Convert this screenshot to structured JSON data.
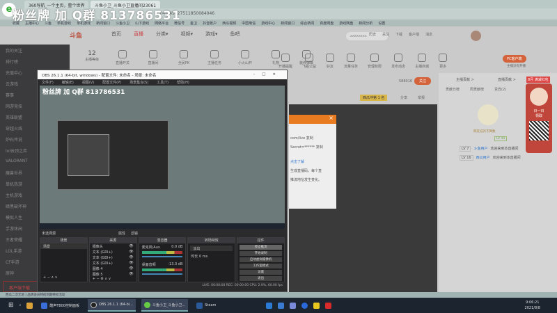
{
  "browser": {
    "tabs": [
      "360导航_一个主页，整个世界",
      "斗鱼小卫_斗鱼小卫直播间23061"
    ],
    "address": "r=0.45627511850084046",
    "bookmarks": [
      "收藏",
      "主播中心",
      "斗鱼",
      "单机游戏",
      "单机游戏",
      "新闻窗口",
      "斗鱼小卫",
      "山下游戏",
      "网络平台",
      "微信号",
      "金卫",
      "抖音账户",
      "西瓜视频",
      "中国电信",
      "游戏中心",
      "新闻窗口",
      "综合新闻",
      "百度网盘",
      "游戏网盘",
      "新闻分析",
      "设置"
    ]
  },
  "overlay_text": "粉丝牌 加 Q群 813786531",
  "site": {
    "logo": "斗鱼",
    "nav": [
      "首页",
      "直播",
      "分类▾",
      "视频▾",
      "游戏▾",
      "鱼吧"
    ],
    "search_placeholder": "xxxxxxxx",
    "header_icons": [
      "历史",
      "关注",
      "下载",
      "客户端",
      "消息"
    ],
    "icons": [
      {
        "value": "12",
        "label": "主播等级"
      },
      {
        "label": "直播开关"
      },
      {
        "label": "直播间"
      },
      {
        "label": "全民PK"
      },
      {
        "label": "主播任务"
      },
      {
        "label": "小火山开"
      },
      {
        "label": "礼物"
      },
      {
        "label": "装修弹幕"
      },
      {
        "label": "开播提醒"
      },
      {
        "label": "飞船公益"
      },
      {
        "label": "好友"
      },
      {
        "label": "流量任务"
      },
      {
        "label": "管理权限"
      },
      {
        "label": "发布动态"
      },
      {
        "label": "主播商城"
      },
      {
        "label": "更多"
      }
    ],
    "pc_button": "PC客户端",
    "pc_sub": "主播没有开播",
    "count": "588016",
    "follow": "关注",
    "rank_badge": "西瓜冲第 1 名",
    "share": "分享",
    "report": "举报",
    "rank_links": [
      "主播贡献 >",
      "直播贡献 >"
    ],
    "rank_tabs": [
      "贡献日榜",
      "周贡献榜",
      "贵宾(2)"
    ]
  },
  "sidebar": [
    "我的关注",
    "排行榜",
    "充值中心",
    "云游戏",
    "赛事",
    "网游竞技",
    "英雄联盟",
    "穿越火线",
    "炉石传说",
    "lol云顶之弈",
    "VALORANT",
    "魔兽世界",
    "单机热游",
    "主机游戏",
    "暗黑破坏神",
    "模拟人生",
    "手游休闲",
    "王者荣耀",
    "LOL手游",
    "CF手游",
    "原神",
    "客户端下载"
  ],
  "dialog": {
    "close": "×",
    "fields": [
      "com/live",
      "Secret=******"
    ],
    "copy": "复制",
    "link": "点击了解",
    "note1": "生成直播码，每个直",
    "note2": "推流地址发生变化。"
  },
  "anchor": {
    "name": "网友说的不算数",
    "level": "LV 40"
  },
  "chat": [
    {
      "lv": "LV 7",
      "user": "斗鱼用户",
      "msg": "欢迎来到本直播间"
    },
    {
      "lv": "LV 16",
      "user": "西瓜用户",
      "msg": "欢迎来到本直播间"
    }
  ],
  "ad": {
    "title": "日一日",
    "sub": "领取",
    "banner": "8月 满减红包"
  },
  "obs": {
    "title": "OBS 26.1.1 (64-bit, windows) - 配置文件: 未命名 - 场景: 未命名",
    "menu": [
      "文件(F)",
      "编辑(E)",
      "视图(V)",
      "配置文件(P)",
      "场景集合(S)",
      "工具(T)",
      "帮助(H)"
    ],
    "no_source": "未选择源",
    "props": "属性",
    "filters": "滤镜",
    "docks": {
      "scenes": "场景",
      "sources": "来源",
      "mixer": "混音器",
      "transitions": "转场特效",
      "controls": "控件"
    },
    "scene_list": [
      "场景"
    ],
    "sources": [
      "摄像头",
      "文本 (GDI+)",
      "文本 (GDI+)",
      "文本 (GDI+)",
      "图像 4",
      "图像 5"
    ],
    "mixer": [
      {
        "name": "麦克风/Aux",
        "db": "0.0 dB"
      },
      {
        "name": "桌面音频",
        "db": "-13.3 dB"
      }
    ],
    "transition": "淡出",
    "duration_label": "时长",
    "duration": "0 ms",
    "controls": [
      "停止推流",
      "开始录制",
      "启动虚拟摄像机",
      "工作室模式",
      "设置",
      "退出"
    ],
    "status": "LIVE: 00:00:00   REC: 00:00:00   CPU: 2.9%, 60.00 fps"
  },
  "bottom_status": "西瓜二次元地 | 品牌会员特权到期特权活动",
  "taskbar": {
    "items": [
      "酷声T800控制面板",
      "OBS 26.1.1 (64-bi...",
      "斗鱼小卫_斗鱼小卫...",
      "Steam"
    ],
    "time": "9:06:21",
    "date": "2021/8/8"
  }
}
